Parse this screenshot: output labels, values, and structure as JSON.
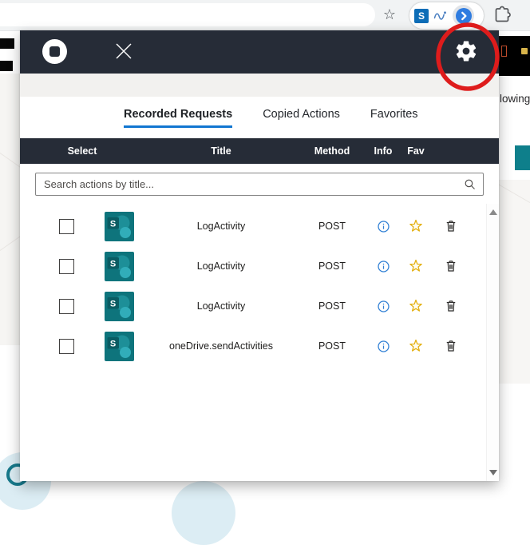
{
  "browser_toolbar": {
    "bookmark_star_glyph": "☆",
    "sharepoint_extension_letter": "S"
  },
  "popup": {
    "tabs": [
      {
        "label": "Recorded Requests",
        "active": true
      },
      {
        "label": "Copied Actions",
        "active": false
      },
      {
        "label": "Favorites",
        "active": false
      }
    ],
    "table_headers": [
      "Select",
      "Title",
      "Method",
      "Info",
      "Fav"
    ],
    "search": {
      "placeholder": "Search actions by title..."
    },
    "connector_letter": "S",
    "rows": [
      {
        "title": "LogActivity",
        "method": "POST"
      },
      {
        "title": "LogActivity",
        "method": "POST"
      },
      {
        "title": "LogActivity",
        "method": "POST"
      },
      {
        "title": "oneDrive.sendActivities",
        "method": "POST"
      }
    ]
  },
  "background_page": {
    "visible_text_fragment": "lowing"
  },
  "colors": {
    "header_bar": "#262c37",
    "active_tab_underline": "#1176d1",
    "sharepoint_teal": "#0e747c",
    "info_blue": "#2f7fd4",
    "favorite_gold": "#e3af0e",
    "annotation_red": "#de1c1c",
    "page_teal_button": "#0e7f8b"
  }
}
